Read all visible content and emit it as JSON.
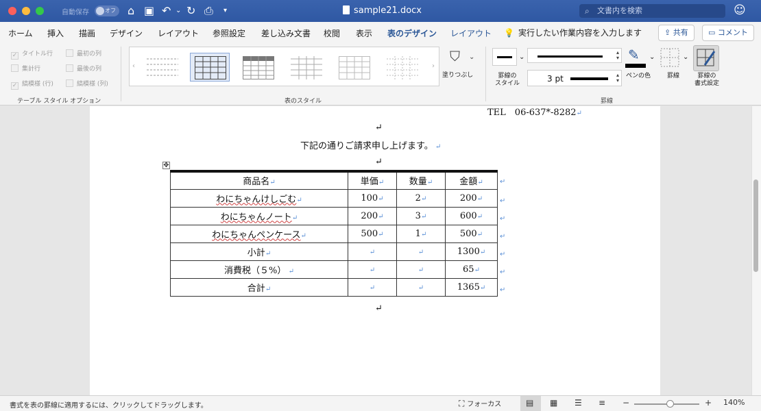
{
  "window": {
    "title": "sample21.docx",
    "autosave_label": "自動保存",
    "autosave_state": "オフ",
    "search_placeholder": "文書内を検索"
  },
  "tabs": [
    "ホーム",
    "挿入",
    "描画",
    "デザイン",
    "レイアウト",
    "参照設定",
    "差し込み文書",
    "校閲",
    "表示",
    "表のデザイン",
    "レイアウト"
  ],
  "active_tab": "表のデザイン",
  "tell_me": "実行したい作業内容を入力します",
  "share_label": "共有",
  "comment_label": "コメント",
  "ribbon": {
    "style_options": {
      "header_row": "タイトル行",
      "total_row": "集計行",
      "banded_rows": "縞模様 (行)",
      "first_column": "最初の列",
      "last_column": "最後の列",
      "banded_columns": "縞模様 (列)",
      "group_label": "テーブル スタイル オプション"
    },
    "table_styles_label": "表のスタイル",
    "shading_label": "塗りつぶし",
    "border_style_label_1": "罫線の",
    "border_style_label_2": "スタイル",
    "pen_weight": "3 pt",
    "pen_color_label": "ペンの色",
    "borders_label": "罫線",
    "border_painter_label_1": "罫線の",
    "border_painter_label_2": "書式設定",
    "borders_group_label": "罫線"
  },
  "document": {
    "tel": "TEL　06-637*-8282",
    "intro": "下記の通りご請求申し上げます。",
    "table": {
      "headers": [
        "商品名",
        "単価",
        "数量",
        "金額"
      ],
      "rows": [
        [
          "わにちゃんけしごむ",
          "100",
          "2",
          "200"
        ],
        [
          "わにちゃんノート",
          "200",
          "3",
          "600"
        ],
        [
          "わにちゃんペンケース",
          "500",
          "1",
          "500"
        ],
        [
          "小計",
          "",
          "",
          "1300"
        ],
        [
          "消費税（５%）",
          "",
          "",
          "65"
        ],
        [
          "合計",
          "",
          "",
          "1365"
        ]
      ]
    }
  },
  "status": {
    "message": "書式を表の罫線に適用するには、クリックしてドラッグします。",
    "focus_label": "フォーカス",
    "zoom": "140%"
  }
}
